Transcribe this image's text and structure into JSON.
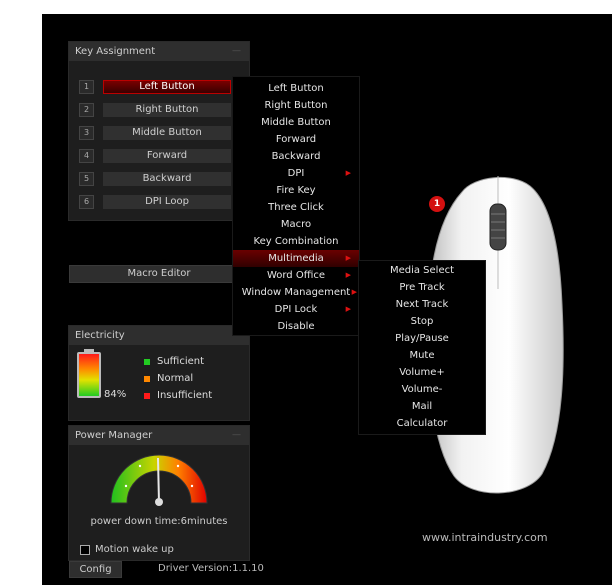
{
  "key_assignment": {
    "title": "Key Assignment",
    "collapse": "—",
    "rows": [
      {
        "num": "1",
        "label": "Left Button"
      },
      {
        "num": "2",
        "label": "Right Button"
      },
      {
        "num": "3",
        "label": "Middle Button"
      },
      {
        "num": "4",
        "label": "Forward"
      },
      {
        "num": "5",
        "label": "Backward"
      },
      {
        "num": "6",
        "label": "DPI Loop"
      }
    ]
  },
  "macro_editor": {
    "label": "Macro Editor"
  },
  "electricity": {
    "title": "Electricity",
    "percent": "84%",
    "level": 0.84,
    "legend": [
      {
        "label": "Sufficient",
        "color": "#22cc22"
      },
      {
        "label": "Normal",
        "color": "#ff8800"
      },
      {
        "label": "Insufficient",
        "color": "#ff1a1a"
      }
    ]
  },
  "power_manager": {
    "title": "Power Manager",
    "collapse": "—",
    "power_down_text": "power down time:6minutes",
    "motion_wake_label": "Motion wake up",
    "motion_wake_checked": false
  },
  "footer": {
    "config_label": "Config",
    "driver_version": "Driver Version:1.1.10",
    "website": "www.intraindustry.com"
  },
  "context_menu": {
    "items": [
      {
        "label": "Left Button",
        "submenu": false
      },
      {
        "label": "Right Button",
        "submenu": false
      },
      {
        "label": "Middle Button",
        "submenu": false
      },
      {
        "label": "Forward",
        "submenu": false
      },
      {
        "label": "Backward",
        "submenu": false
      },
      {
        "label": "DPI",
        "submenu": true
      },
      {
        "label": "Fire Key",
        "submenu": false
      },
      {
        "label": "Three Click",
        "submenu": false
      },
      {
        "label": "Macro",
        "submenu": false
      },
      {
        "label": "Key Combination",
        "submenu": false
      },
      {
        "label": "Multimedia",
        "submenu": true,
        "highlighted": true
      },
      {
        "label": "Word Office",
        "submenu": true
      },
      {
        "label": "Window Management",
        "submenu": true
      },
      {
        "label": "DPI Lock",
        "submenu": true
      },
      {
        "label": "Disable",
        "submenu": false
      }
    ]
  },
  "multimedia_submenu": {
    "items": [
      "Media Select",
      "Pre Track",
      "Next Track",
      "Stop",
      "Play/Pause",
      "Mute",
      "Volume+",
      "Volume-",
      "Mail",
      "Calculator"
    ]
  },
  "mouse": {
    "badge": "1"
  },
  "colors": {
    "accent": "#b00000",
    "background": "#000000",
    "panel": "#1e1e1e"
  }
}
